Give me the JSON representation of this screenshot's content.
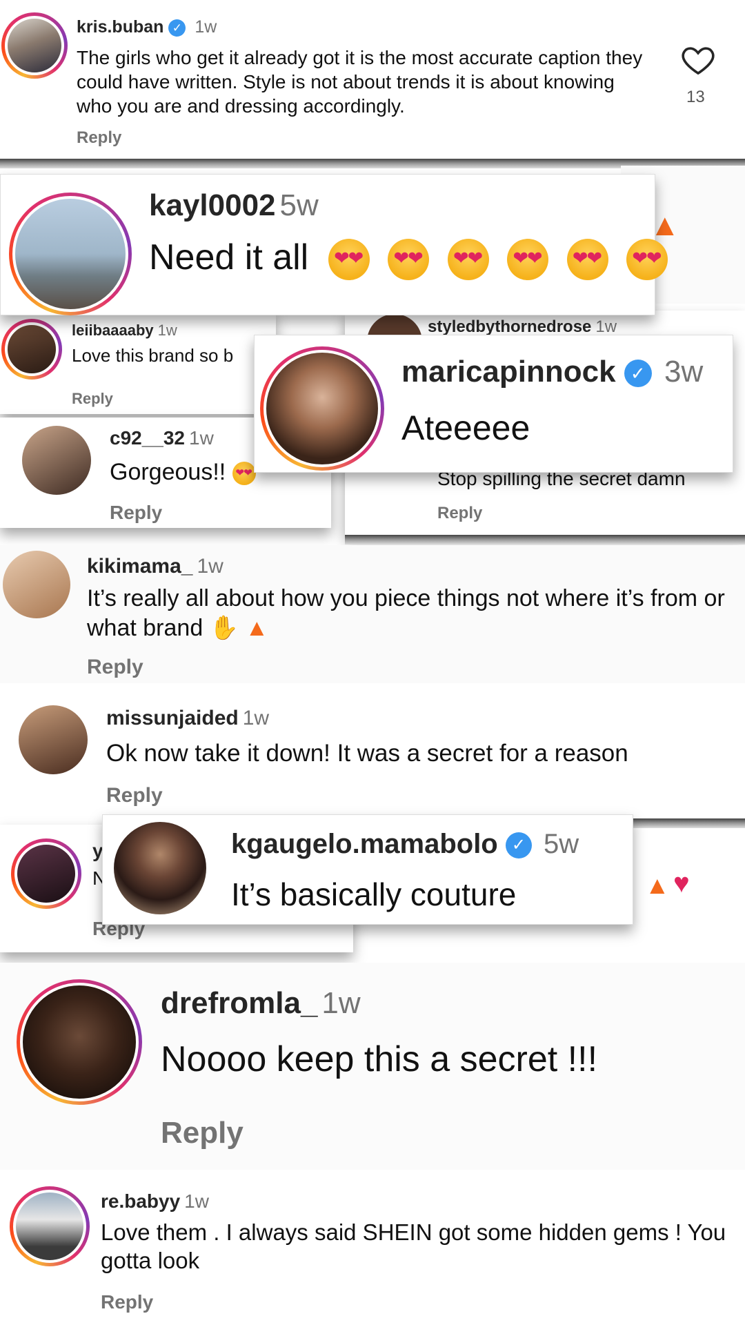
{
  "comments": {
    "kris": {
      "user": "kris.buban",
      "time": "1w",
      "text": "The girls who get it already got it is the most accurate caption they could have written. Style is not about trends it is about knowing who you are and dressing accordingly.",
      "reply": "Reply",
      "likes": "13",
      "icon": "heart-outline-icon"
    },
    "kayl": {
      "user": "kayl0002",
      "time": "5w",
      "text": "Need it all"
    },
    "leii": {
      "user": "leiibaaaaby",
      "time": "1w",
      "text": "Love this brand so b",
      "reply": "Reply"
    },
    "styled": {
      "user": "styledbythornedrose",
      "time": "1w",
      "text": "Stop spilling the secret damn",
      "reply": "Reply"
    },
    "marica": {
      "user": "maricapinnock",
      "time": "3w",
      "text": "Ateeeee"
    },
    "c92": {
      "user": "c92__32",
      "time": "1w",
      "text": "Gorgeous!!",
      "reply": "Reply"
    },
    "kiki": {
      "user": "kikimama_",
      "time": "1w",
      "text": "It’s really all about how you piece things not where it’s from or what brand",
      "reply": "Reply"
    },
    "miss": {
      "user": "missunjaided",
      "time": "1w",
      "text": "Ok now take it down! It was a secret for a reason",
      "reply": "Reply"
    },
    "partial": {
      "user": "y",
      "text": "N",
      "reply": "Reply"
    },
    "kgaugelo": {
      "user": "kgaugelo.mamabolo",
      "time": "5w",
      "text": "It’s basically couture"
    },
    "dre": {
      "user": "drefromla_",
      "time": "1w",
      "text": "Noooo keep this a secret !!!",
      "reply": "Reply"
    },
    "re": {
      "user": "re.babyy",
      "time": "1w",
      "text": "Love them . I always said SHEIN got some hidden gems ! You gotta look",
      "reply": "Reply"
    }
  },
  "colors": {
    "verified": "#3897f0",
    "meta": "#737373",
    "fire": "#f46a1b",
    "heart": "#e0245e"
  }
}
